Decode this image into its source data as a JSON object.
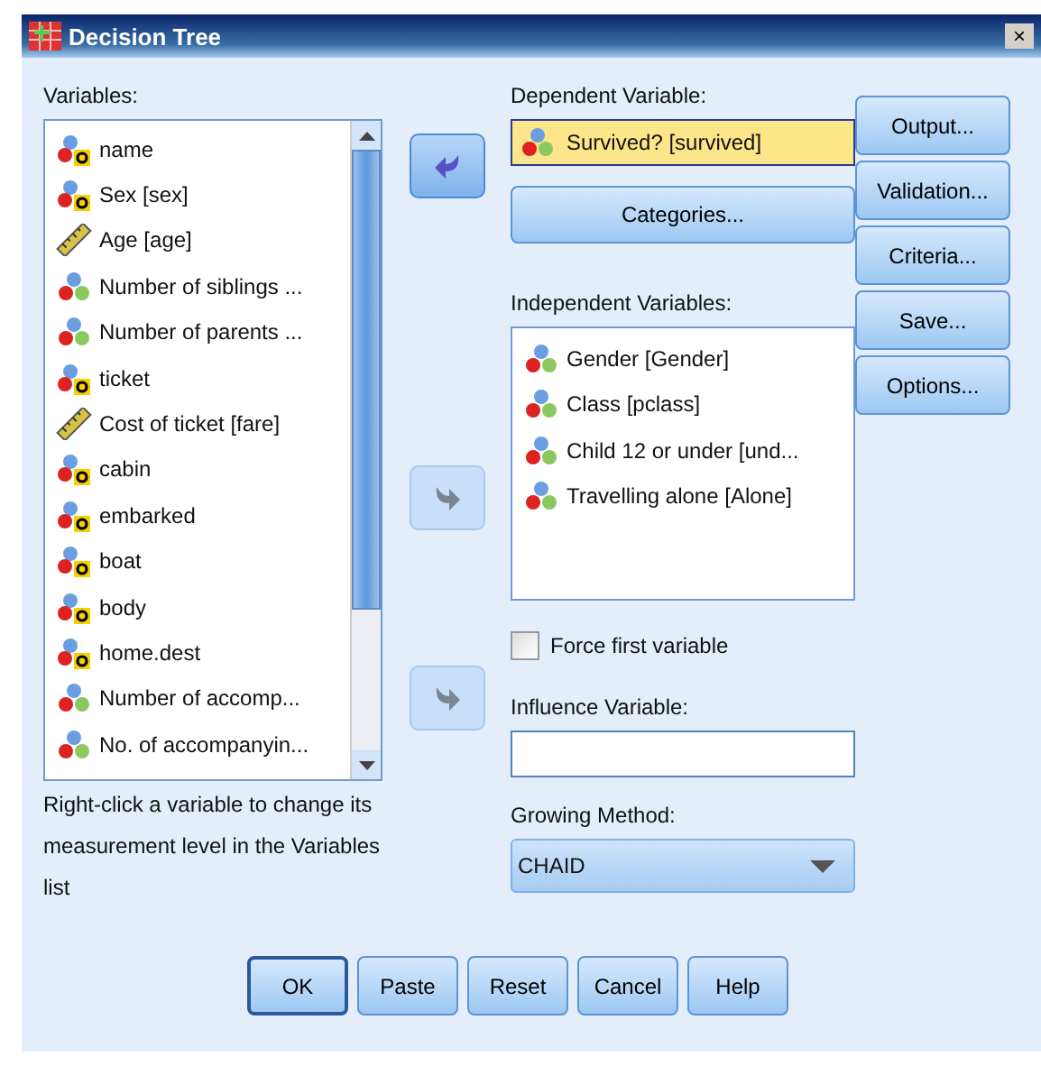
{
  "window": {
    "title": "Decision Tree",
    "close": "×"
  },
  "variables": {
    "label": "Variables:",
    "items": [
      {
        "name": "name",
        "kind": "string"
      },
      {
        "name": "Sex [sex]",
        "kind": "string"
      },
      {
        "name": "Age [age]",
        "kind": "scale"
      },
      {
        "name": "Number of siblings ...",
        "kind": "nominal"
      },
      {
        "name": "Number of parents ...",
        "kind": "nominal"
      },
      {
        "name": "ticket",
        "kind": "string"
      },
      {
        "name": "Cost of ticket [fare]",
        "kind": "scale"
      },
      {
        "name": "cabin",
        "kind": "string"
      },
      {
        "name": "embarked",
        "kind": "string"
      },
      {
        "name": "boat",
        "kind": "string"
      },
      {
        "name": "body",
        "kind": "string"
      },
      {
        "name": "home.dest",
        "kind": "string"
      },
      {
        "name": "Number of accomp...",
        "kind": "nominal"
      },
      {
        "name": "No. of accompanyin...",
        "kind": "nominal"
      }
    ],
    "hint": "Right-click a variable to change its measurement level in the Variables list"
  },
  "arrows": [
    {
      "kind": "left",
      "disabled": false
    },
    {
      "kind": "right",
      "disabled": true
    },
    {
      "kind": "right",
      "disabled": true
    }
  ],
  "dependent": {
    "label": "Dependent Variable:",
    "value": {
      "name": "Survived? [survived]",
      "kind": "nominal",
      "selected": true
    },
    "categories_button": "Categories..."
  },
  "independent": {
    "label": "Independent Variables:",
    "items": [
      {
        "name": "Gender [Gender]",
        "kind": "nominal"
      },
      {
        "name": "Class [pclass]",
        "kind": "nominal"
      },
      {
        "name": "Child 12 or under [und...",
        "kind": "nominal"
      },
      {
        "name": "Travelling alone [Alone]",
        "kind": "nominal"
      }
    ]
  },
  "force_first": {
    "label": "Force first variable",
    "checked": false
  },
  "influence": {
    "label": "Influence Variable:"
  },
  "growing": {
    "label": "Growing Method:",
    "value": "CHAID"
  },
  "side_buttons": [
    "Output...",
    "Validation...",
    "Criteria...",
    "Save...",
    "Options..."
  ],
  "bottom_buttons": [
    {
      "label": "OK",
      "default": true
    },
    {
      "label": "Paste",
      "default": false
    },
    {
      "label": "Reset",
      "default": false
    },
    {
      "label": "Cancel",
      "default": false
    },
    {
      "label": "Help",
      "default": false
    }
  ]
}
